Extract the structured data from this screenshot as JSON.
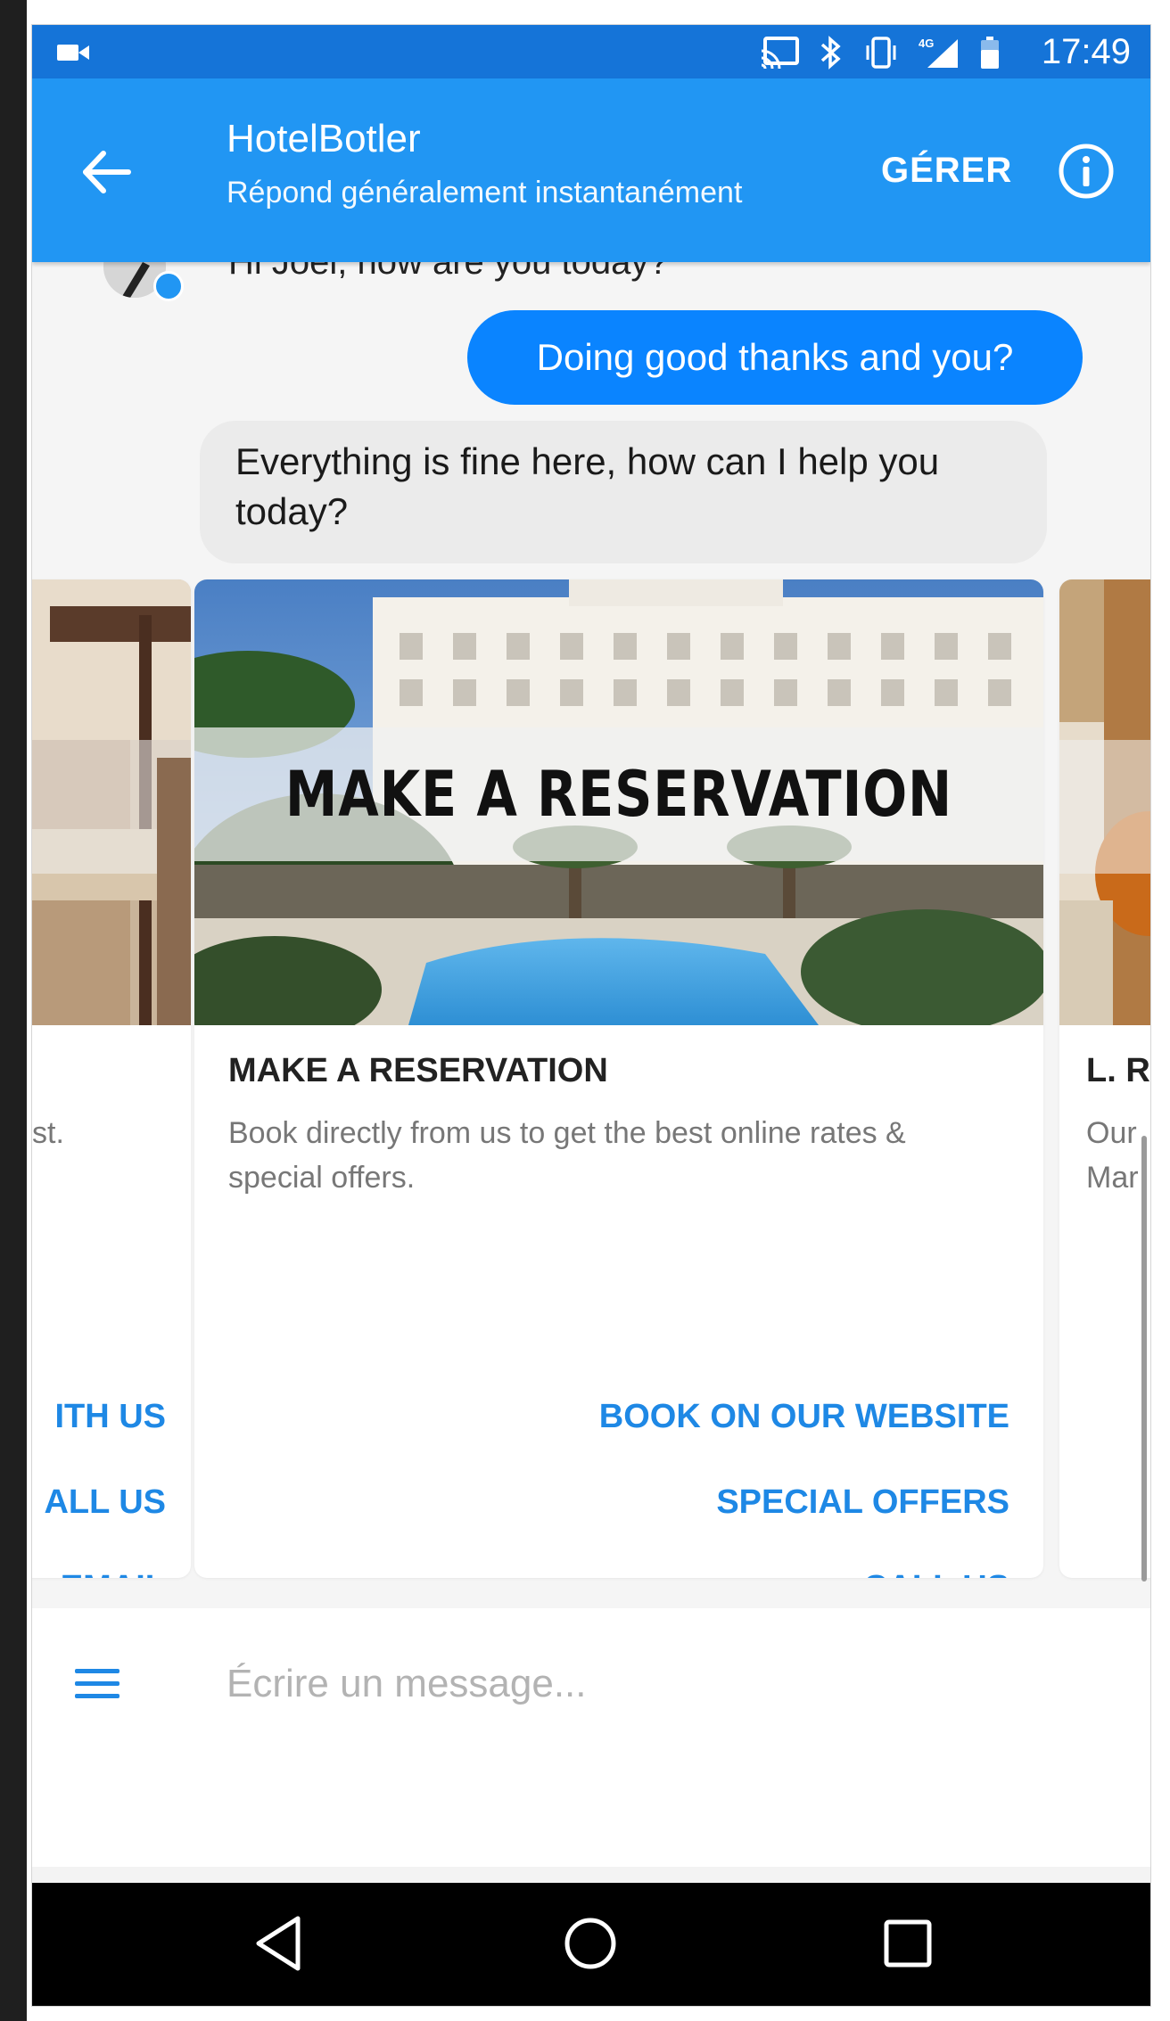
{
  "status_bar": {
    "time": "17:49",
    "icons": [
      "video-camera-icon",
      "cast-icon",
      "bluetooth-icon",
      "vibrate-icon",
      "signal-4g-icon",
      "battery-icon"
    ]
  },
  "header": {
    "title": "HotelBotler",
    "subtitle": "Répond généralement instantanément",
    "manage_label": "GÉRER",
    "icons": [
      "back-arrow-icon",
      "info-icon"
    ]
  },
  "conversation": {
    "previous_message_fragment": "Hi Joel, how are you today?",
    "user_message": "Doing good thanks and you?",
    "bot_message": "Everything is fine here, how can I help you today?"
  },
  "carousel": {
    "left_card": {
      "desc_fragment": "st.",
      "buttons": [
        "ITH US",
        "ALL US",
        "EMAIL"
      ]
    },
    "main_card": {
      "image_banner": "MAKE A RESERVATION",
      "title": "MAKE A RESERVATION",
      "description": "Book directly from us to get the best online rates & special offers.",
      "buttons": [
        "BOOK ON OUR WEBSITE",
        "SPECIAL OFFERS",
        "CALL US"
      ]
    },
    "right_card": {
      "title_fragment": "L. R",
      "desc_line1": "Our",
      "desc_line2": "Mar"
    }
  },
  "composer": {
    "placeholder": "Écrire un message...",
    "icons": [
      "hamburger-menu-icon"
    ]
  },
  "nav_bar": {
    "icons": [
      "nav-back-icon",
      "nav-home-icon",
      "nav-recents-icon"
    ]
  },
  "colors": {
    "status_bar": "#1574d8",
    "header": "#2196f3",
    "user_bubble": "#0a84ff",
    "bot_bubble": "#ebebeb",
    "link": "#1e88e5"
  }
}
